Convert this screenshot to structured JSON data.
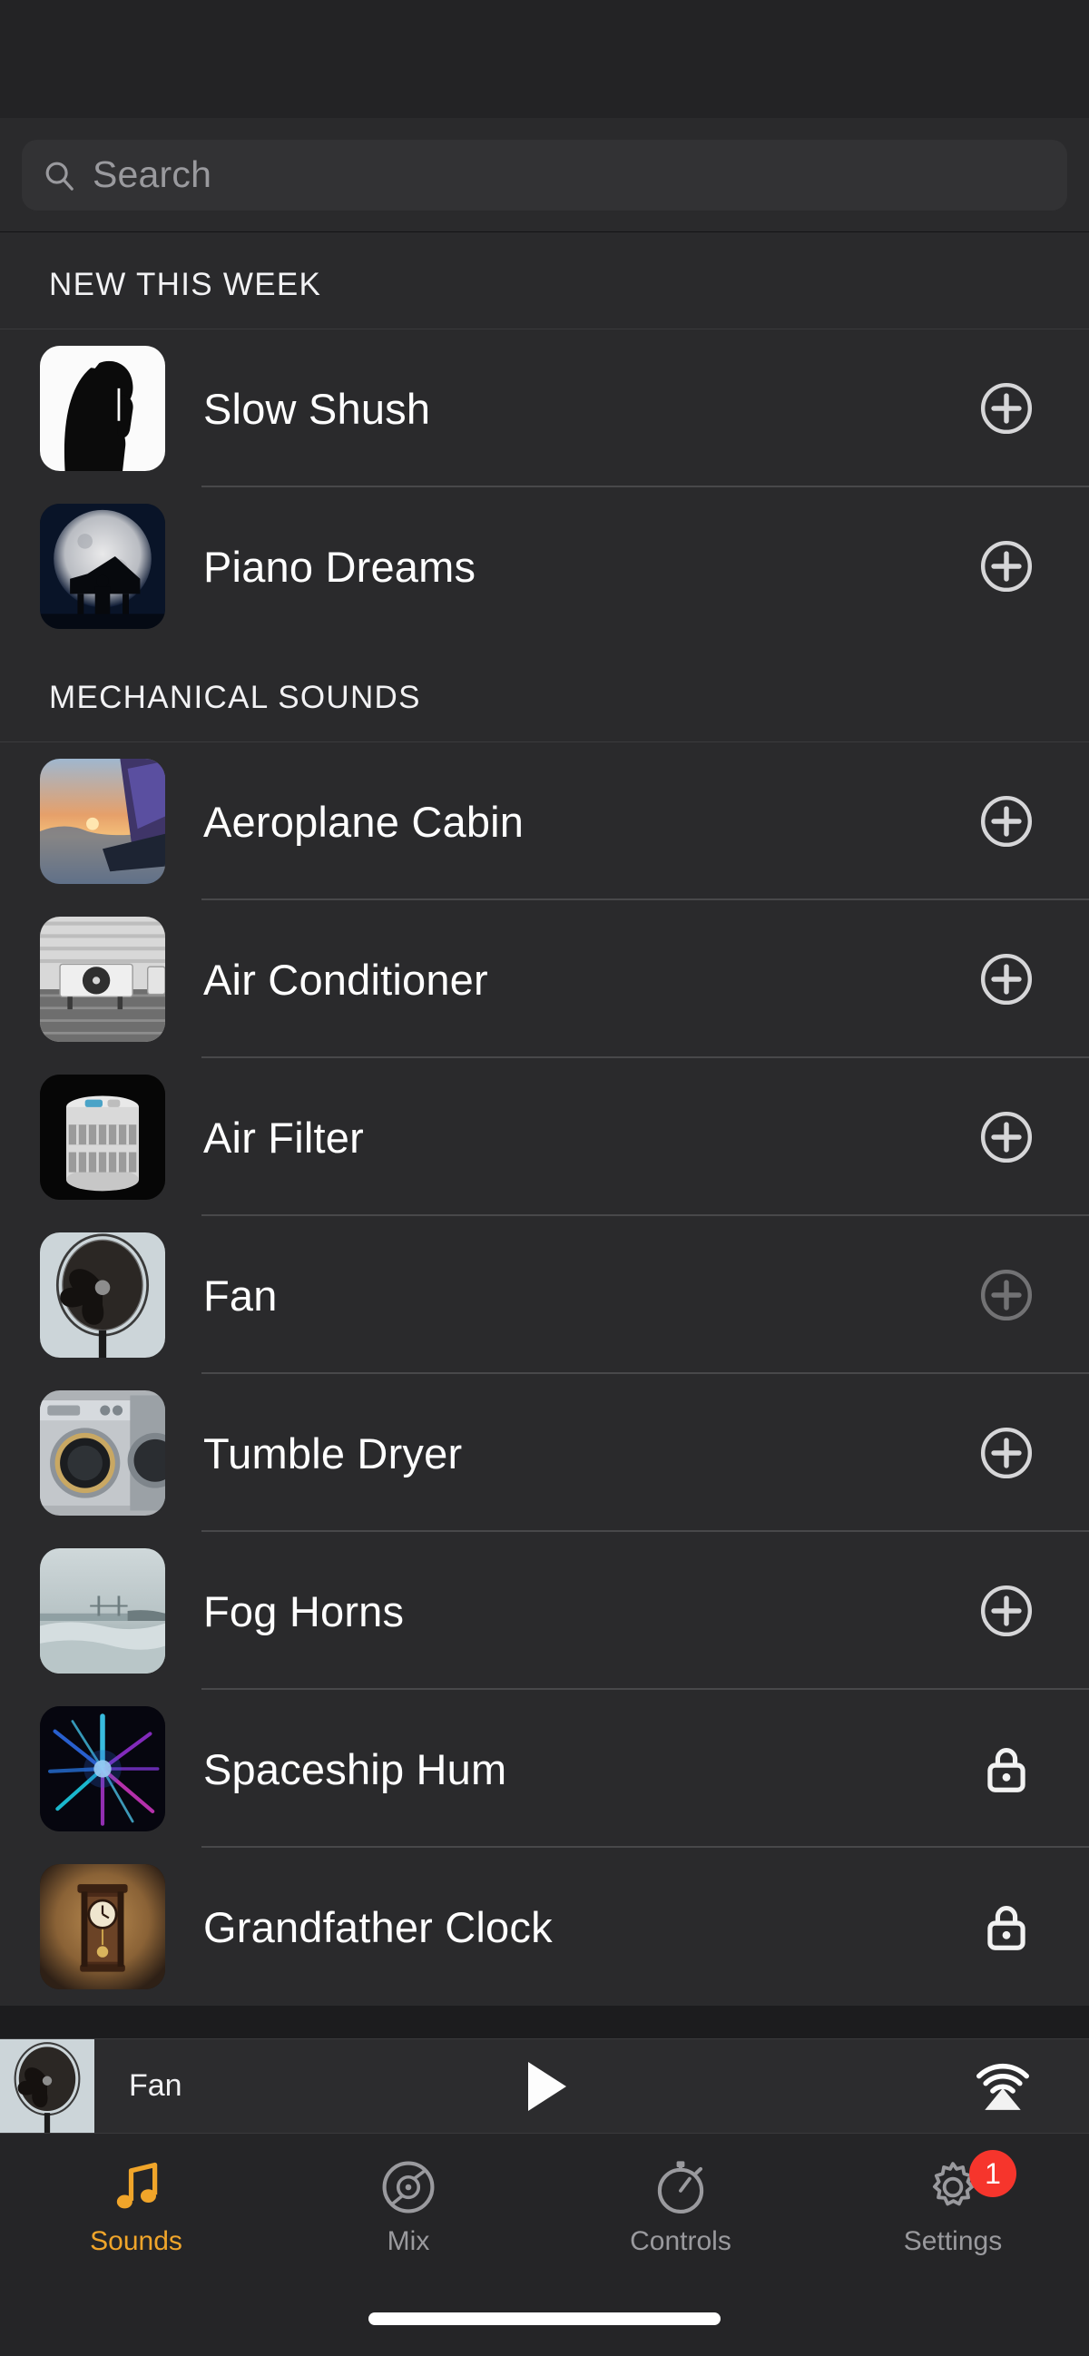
{
  "app": {
    "accent_color": "#f0a52a",
    "background_color": "#1c1c1e",
    "row_background_color": "#2a2a2c",
    "badge_color": "#f6352c"
  },
  "search": {
    "placeholder": "Search",
    "value": "",
    "icon": "search-icon"
  },
  "sections": [
    {
      "title": "NEW THIS WEEK",
      "items": [
        {
          "label": "Slow Shush",
          "thumb": "shush",
          "action": "add",
          "action_icon": "plus-circle-icon",
          "state": "available"
        },
        {
          "label": "Piano Dreams",
          "thumb": "piano",
          "action": "add",
          "action_icon": "plus-circle-icon",
          "state": "available"
        }
      ]
    },
    {
      "title": "MECHANICAL SOUNDS",
      "items": [
        {
          "label": "Aeroplane Cabin",
          "thumb": "plane",
          "action": "add",
          "action_icon": "plus-circle-icon",
          "state": "available"
        },
        {
          "label": "Air Conditioner",
          "thumb": "ac",
          "action": "add",
          "action_icon": "plus-circle-icon",
          "state": "available"
        },
        {
          "label": "Air Filter",
          "thumb": "filter",
          "action": "add",
          "action_icon": "plus-circle-icon",
          "state": "available"
        },
        {
          "label": "Fan",
          "thumb": "fan",
          "action": "add",
          "action_icon": "plus-circle-icon",
          "state": "added"
        },
        {
          "label": "Tumble Dryer",
          "thumb": "dryer",
          "action": "add",
          "action_icon": "plus-circle-icon",
          "state": "available"
        },
        {
          "label": "Fog Horns",
          "thumb": "fog",
          "action": "add",
          "action_icon": "plus-circle-icon",
          "state": "available"
        },
        {
          "label": "Spaceship Hum",
          "thumb": "space",
          "action": "lock",
          "action_icon": "lock-icon",
          "state": "locked"
        },
        {
          "label": "Grandfather Clock",
          "thumb": "clock",
          "action": "lock",
          "action_icon": "lock-icon",
          "state": "locked"
        }
      ]
    }
  ],
  "player": {
    "title": "Fan",
    "thumb": "fan",
    "play_icon": "play-icon",
    "airplay_icon": "airplay-icon",
    "is_playing": false
  },
  "tabbar": {
    "active": "Sounds",
    "tabs": [
      {
        "label": "Sounds",
        "icon": "music-note-icon",
        "active": true,
        "badge": ""
      },
      {
        "label": "Mix",
        "icon": "vinyl-record-icon",
        "active": false,
        "badge": ""
      },
      {
        "label": "Controls",
        "icon": "stopwatch-icon",
        "active": false,
        "badge": ""
      },
      {
        "label": "Settings",
        "icon": "gear-icon",
        "active": false,
        "badge": "1"
      }
    ]
  }
}
